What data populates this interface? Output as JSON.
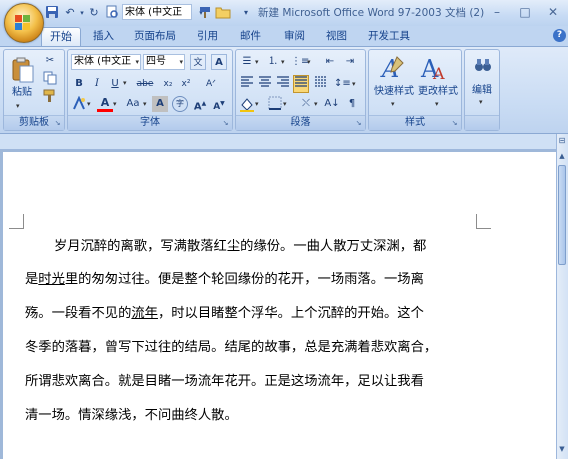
{
  "colors": {
    "ribbon_blue": "#15428b",
    "title_text": "#3e5f91",
    "office_orb": "#f3c04a"
  },
  "title_bar": {
    "quick_font": "宋体 (中文正",
    "doc_title": "新建 Microsoft Office Word 97-2003 文档 (2)",
    "minimize": "–",
    "maximize": "□",
    "close": "✕"
  },
  "tabs": [
    "开始",
    "插入",
    "页面布局",
    "引用",
    "邮件",
    "审阅",
    "视图",
    "开发工具"
  ],
  "help": "?",
  "ribbon": {
    "clipboard": {
      "label": "剪贴板",
      "paste": "粘贴"
    },
    "font": {
      "label": "字体",
      "font_name": "宋体 (中文正",
      "font_size": "四号",
      "bold": "B",
      "italic": "I",
      "underline": "U",
      "strike": "abe",
      "subscript": "x₂",
      "superscript": "x²",
      "grow": "A",
      "shrink": "A",
      "aa": "Aa"
    },
    "paragraph": {
      "label": "段落"
    },
    "styles": {
      "label": "样式",
      "quick_styles": "快速样式",
      "change_styles": "更改样式"
    },
    "editing": {
      "label": "",
      "edit": "编辑"
    }
  },
  "document": {
    "lines": [
      [
        "岁月沉醉的离歌，写满散落红尘的缘份。一曲人散万丈深渊，都"
      ],
      [
        "是",
        "时光",
        "里的匆匆过往。便是整个轮回缘份的花开，一场雨落。一场离"
      ],
      [
        "殇。一段看不见的",
        "流年",
        "，时以目睹整个浮华。上个沉醉的开始。这个"
      ],
      [
        "冬季的落暮，曾写下过往的结局。结尾的故事，总是充满着悲欢离合，"
      ],
      [
        "所谓悲欢离合。就是目睹一场流年花开。正是这场流年，足以让我看"
      ],
      [
        "清一场。情深缘浅，不问曲终人散。"
      ]
    ]
  }
}
